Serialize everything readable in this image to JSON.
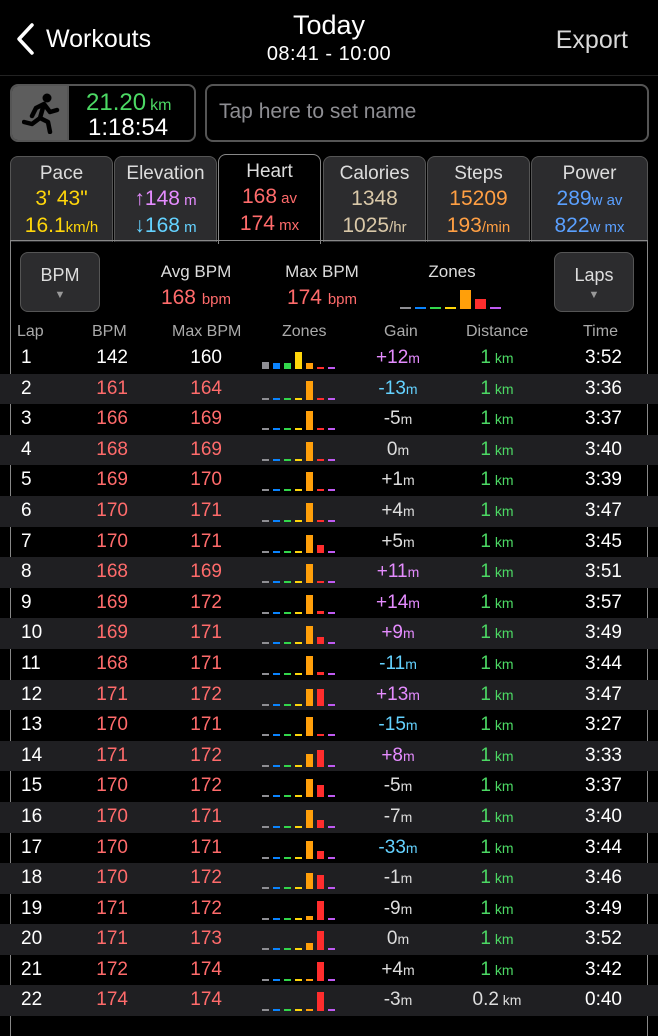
{
  "header": {
    "back_label": "Workouts",
    "title": "Today",
    "subtitle": "08:41 - 10:00",
    "export_label": "Export"
  },
  "summary": {
    "distance": "21.20",
    "distance_unit": "km",
    "duration": "1:18:54",
    "name_placeholder": "Tap here to set name",
    "activity_icon": "running-person-icon"
  },
  "tabs": [
    {
      "label": "Pace",
      "line1": "3' 43\"",
      "unit1": "",
      "line2": "16.1",
      "unit2": "km/h",
      "color1": "#ffd60a",
      "color2": "#ffd60a"
    },
    {
      "label": "Elevation",
      "line1": "↑148",
      "unit1": " m",
      "line2": "↓168",
      "unit2": " m",
      "color1": "#e58cff",
      "color2": "#64d2ff"
    },
    {
      "label": "Heart",
      "line1": "168",
      "unit1": " av",
      "line2": "174",
      "unit2": " mx",
      "color1": "#ff6b6b",
      "color2": "#ff6b6b"
    },
    {
      "label": "Calories",
      "line1": "1348",
      "unit1": "",
      "line2": "1025",
      "unit2": "/hr",
      "color1": "#d9c8a8",
      "color2": "#d9c8a8"
    },
    {
      "label": "Steps",
      "line1": "15209",
      "unit1": "",
      "line2": "193",
      "unit2": "/min",
      "color1": "#ff9f43",
      "color2": "#ff9f43"
    },
    {
      "label": "Power",
      "line1": "289",
      "unit1": "w av",
      "line2": "822",
      "unit2": "w mx",
      "color1": "#5aa0ff",
      "color2": "#5aa0ff"
    }
  ],
  "panel": {
    "bpm_button": "BPM",
    "laps_button": "Laps",
    "avg_label": "Avg BPM",
    "avg_value": "168",
    "avg_unit": "bpm",
    "max_label": "Max BPM",
    "max_value": "174",
    "max_unit": "bpm",
    "zones_label": "Zones",
    "zone_summary": [
      0.03,
      0.03,
      0.03,
      0.03,
      0.85,
      0.45,
      0.03
    ]
  },
  "colors": {
    "zones": [
      "#8e8e93",
      "#0a84ff",
      "#32d74b",
      "#ffd60a",
      "#ff9f0a",
      "#ff2d2d",
      "#bf5af2"
    ],
    "bpm_normal": "#ffffff",
    "bpm_high": "#ff6b6b",
    "distance": "#4cd964"
  },
  "table": {
    "headers": {
      "lap": "Lap",
      "bpm": "BPM",
      "max": "Max BPM",
      "zones": "Zones",
      "gain": "Gain",
      "distance": "Distance",
      "time": "Time"
    },
    "rows": [
      {
        "lap": "1",
        "bpm": "142",
        "max": "160",
        "gain": "+12",
        "gain_unit": "m",
        "gain_color": "#e58cff",
        "dist": "1",
        "dist_unit": "km",
        "time": "3:52",
        "hl": false,
        "zones": [
          0.35,
          0.3,
          0.3,
          0.85,
          0.3,
          0.05,
          0.05
        ]
      },
      {
        "lap": "2",
        "bpm": "161",
        "max": "164",
        "gain": "-13",
        "gain_unit": "m",
        "gain_color": "#64d2ff",
        "dist": "1",
        "dist_unit": "km",
        "time": "3:36",
        "hl": true,
        "zones": [
          0.03,
          0.03,
          0.03,
          0.03,
          0.95,
          0.03,
          0.03
        ]
      },
      {
        "lap": "3",
        "bpm": "166",
        "max": "169",
        "gain": "-5",
        "gain_unit": "m",
        "gain_color": "#ddd",
        "dist": "1",
        "dist_unit": "km",
        "time": "3:37",
        "hl": true,
        "zones": [
          0.03,
          0.03,
          0.03,
          0.03,
          0.95,
          0.03,
          0.03
        ]
      },
      {
        "lap": "4",
        "bpm": "168",
        "max": "169",
        "gain": "0",
        "gain_unit": "m",
        "gain_color": "#ddd",
        "dist": "1",
        "dist_unit": "km",
        "time": "3:40",
        "hl": true,
        "zones": [
          0.03,
          0.03,
          0.03,
          0.03,
          0.95,
          0.03,
          0.03
        ]
      },
      {
        "lap": "5",
        "bpm": "169",
        "max": "170",
        "gain": "+1",
        "gain_unit": "m",
        "gain_color": "#ddd",
        "dist": "1",
        "dist_unit": "km",
        "time": "3:39",
        "hl": true,
        "zones": [
          0.03,
          0.03,
          0.03,
          0.03,
          0.95,
          0.03,
          0.03
        ]
      },
      {
        "lap": "6",
        "bpm": "170",
        "max": "171",
        "gain": "+4",
        "gain_unit": "m",
        "gain_color": "#ddd",
        "dist": "1",
        "dist_unit": "km",
        "time": "3:47",
        "hl": true,
        "zones": [
          0.03,
          0.03,
          0.03,
          0.03,
          0.95,
          0.1,
          0.03
        ]
      },
      {
        "lap": "7",
        "bpm": "170",
        "max": "171",
        "gain": "+5",
        "gain_unit": "m",
        "gain_color": "#ddd",
        "dist": "1",
        "dist_unit": "km",
        "time": "3:45",
        "hl": true,
        "zones": [
          0.03,
          0.03,
          0.03,
          0.03,
          0.9,
          0.4,
          0.03
        ]
      },
      {
        "lap": "8",
        "bpm": "168",
        "max": "169",
        "gain": "+11",
        "gain_unit": "m",
        "gain_color": "#e58cff",
        "dist": "1",
        "dist_unit": "km",
        "time": "3:51",
        "hl": true,
        "zones": [
          0.03,
          0.03,
          0.03,
          0.03,
          0.95,
          0.03,
          0.03
        ]
      },
      {
        "lap": "9",
        "bpm": "169",
        "max": "172",
        "gain": "+14",
        "gain_unit": "m",
        "gain_color": "#e58cff",
        "dist": "1",
        "dist_unit": "km",
        "time": "3:57",
        "hl": true,
        "zones": [
          0.03,
          0.03,
          0.03,
          0.03,
          0.95,
          0.15,
          0.03
        ]
      },
      {
        "lap": "10",
        "bpm": "169",
        "max": "171",
        "gain": "+9",
        "gain_unit": "m",
        "gain_color": "#e58cff",
        "dist": "1",
        "dist_unit": "km",
        "time": "3:49",
        "hl": true,
        "zones": [
          0.03,
          0.03,
          0.03,
          0.03,
          0.9,
          0.35,
          0.03
        ]
      },
      {
        "lap": "11",
        "bpm": "168",
        "max": "171",
        "gain": "-11",
        "gain_unit": "m",
        "gain_color": "#64d2ff",
        "dist": "1",
        "dist_unit": "km",
        "time": "3:44",
        "hl": true,
        "zones": [
          0.03,
          0.03,
          0.03,
          0.03,
          0.95,
          0.15,
          0.03
        ]
      },
      {
        "lap": "12",
        "bpm": "171",
        "max": "172",
        "gain": "+13",
        "gain_unit": "m",
        "gain_color": "#e58cff",
        "dist": "1",
        "dist_unit": "km",
        "time": "3:47",
        "hl": true,
        "zones": [
          0.03,
          0.03,
          0.03,
          0.03,
          0.85,
          0.85,
          0.03
        ]
      },
      {
        "lap": "13",
        "bpm": "170",
        "max": "171",
        "gain": "-15",
        "gain_unit": "m",
        "gain_color": "#64d2ff",
        "dist": "1",
        "dist_unit": "km",
        "time": "3:27",
        "hl": true,
        "zones": [
          0.03,
          0.03,
          0.03,
          0.03,
          0.95,
          0.03,
          0.03
        ]
      },
      {
        "lap": "14",
        "bpm": "171",
        "max": "172",
        "gain": "+8",
        "gain_unit": "m",
        "gain_color": "#e58cff",
        "dist": "1",
        "dist_unit": "km",
        "time": "3:33",
        "hl": true,
        "zones": [
          0.03,
          0.03,
          0.03,
          0.03,
          0.65,
          0.85,
          0.03
        ]
      },
      {
        "lap": "15",
        "bpm": "170",
        "max": "172",
        "gain": "-5",
        "gain_unit": "m",
        "gain_color": "#ddd",
        "dist": "1",
        "dist_unit": "km",
        "time": "3:37",
        "hl": true,
        "zones": [
          0.03,
          0.03,
          0.03,
          0.03,
          0.9,
          0.6,
          0.03
        ]
      },
      {
        "lap": "16",
        "bpm": "170",
        "max": "171",
        "gain": "-7",
        "gain_unit": "m",
        "gain_color": "#ddd",
        "dist": "1",
        "dist_unit": "km",
        "time": "3:40",
        "hl": true,
        "zones": [
          0.03,
          0.03,
          0.03,
          0.03,
          0.9,
          0.4,
          0.03
        ]
      },
      {
        "lap": "17",
        "bpm": "170",
        "max": "171",
        "gain": "-33",
        "gain_unit": "m",
        "gain_color": "#64d2ff",
        "dist": "1",
        "dist_unit": "km",
        "time": "3:44",
        "hl": true,
        "zones": [
          0.03,
          0.03,
          0.03,
          0.03,
          0.9,
          0.4,
          0.03
        ]
      },
      {
        "lap": "18",
        "bpm": "170",
        "max": "172",
        "gain": "-1",
        "gain_unit": "m",
        "gain_color": "#ddd",
        "dist": "1",
        "dist_unit": "km",
        "time": "3:46",
        "hl": true,
        "zones": [
          0.03,
          0.03,
          0.03,
          0.03,
          0.8,
          0.7,
          0.03
        ]
      },
      {
        "lap": "19",
        "bpm": "171",
        "max": "172",
        "gain": "-9",
        "gain_unit": "m",
        "gain_color": "#ddd",
        "dist": "1",
        "dist_unit": "km",
        "time": "3:49",
        "hl": true,
        "zones": [
          0.03,
          0.03,
          0.03,
          0.03,
          0.2,
          0.95,
          0.03
        ]
      },
      {
        "lap": "20",
        "bpm": "171",
        "max": "173",
        "gain": "0",
        "gain_unit": "m",
        "gain_color": "#ddd",
        "dist": "1",
        "dist_unit": "km",
        "time": "3:52",
        "hl": true,
        "zones": [
          0.03,
          0.03,
          0.03,
          0.03,
          0.35,
          0.95,
          0.03
        ]
      },
      {
        "lap": "21",
        "bpm": "172",
        "max": "174",
        "gain": "+4",
        "gain_unit": "m",
        "gain_color": "#ddd",
        "dist": "1",
        "dist_unit": "km",
        "time": "3:42",
        "hl": true,
        "zones": [
          0.03,
          0.03,
          0.03,
          0.03,
          0.05,
          0.95,
          0.03
        ]
      },
      {
        "lap": "22",
        "bpm": "174",
        "max": "174",
        "gain": "-3",
        "gain_unit": "m",
        "gain_color": "#ddd",
        "dist": "0.2",
        "dist_unit": "km",
        "time": "0:40",
        "hl": true,
        "zones": [
          0.03,
          0.03,
          0.03,
          0.03,
          0.05,
          0.95,
          0.03
        ]
      }
    ]
  }
}
